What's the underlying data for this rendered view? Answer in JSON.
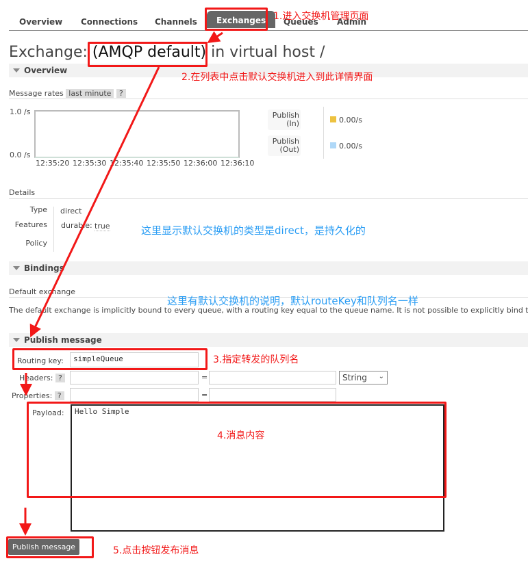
{
  "nav": {
    "tabs": [
      "Overview",
      "Connections",
      "Channels",
      "Exchanges",
      "Queues",
      "Admin"
    ],
    "active": "Exchanges"
  },
  "title": {
    "prefix": "Exchange:",
    "name": "(AMQP default)",
    "suffix": "in virtual host /"
  },
  "overview": {
    "header": "Overview",
    "rates_label": "Message rates",
    "rates_range": "last minute",
    "help": "?",
    "chart": {
      "type": "line",
      "y_ticks": [
        "1.0 /s",
        "0.0 /s"
      ],
      "x_ticks": [
        "12:35:20",
        "12:35:30",
        "12:35:40",
        "12:35:50",
        "12:36:00",
        "12:36:10"
      ]
    },
    "legend": [
      {
        "label_line1": "Publish",
        "label_line2": "(In)",
        "value": "0.00/s",
        "color": "#edc240"
      },
      {
        "label_line1": "Publish",
        "label_line2": "(Out)",
        "value": "0.00/s",
        "color": "#afd8f8"
      }
    ],
    "details_label": "Details",
    "type_label": "Type",
    "type_value": "direct",
    "features_label": "Features",
    "durable_label": "durable:",
    "durable_value": "true",
    "policy_label": "Policy"
  },
  "bindings": {
    "header": "Bindings",
    "default_label": "Default exchange",
    "description": "The default exchange is implicitly bound to every queue, with a routing key equal to the queue name. It is not possible to explicitly bind to,"
  },
  "publish": {
    "header": "Publish message",
    "routing_key_label": "Routing key:",
    "routing_key_value": "simpleQueue",
    "headers_label": "Headers:",
    "properties_label": "Properties:",
    "help": "?",
    "equals": "=",
    "type_select": "String",
    "payload_label": "Payload:",
    "payload_value": "Hello Simple",
    "button": "Publish message"
  },
  "annotations": {
    "a1": "1.进入交换机管理页面",
    "a2": "2.在列表中点击默认交换机进入到此详情界面",
    "a3": "这里显示默认交换机的类型是direct，是持久化的",
    "a4": "这里有默认交换机的说明，默认routeKey和队列名一样",
    "a5": "3.指定转发的队列名",
    "a6": "4.消息内容",
    "a7": "5.点击按钮发布消息"
  }
}
